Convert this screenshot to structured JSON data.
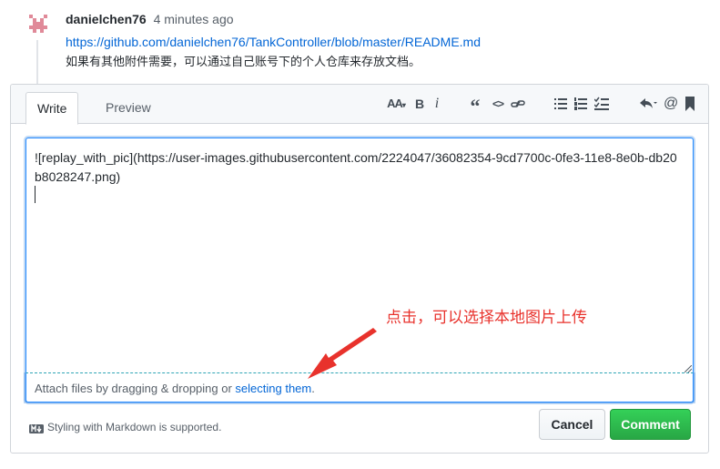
{
  "comment": {
    "author": "danielchen76",
    "time": "4 minutes ago",
    "link": "https://github.com/danielchen76/TankController/blob/master/README.md",
    "text": "如果有其他附件需要，可以通过自己账号下的个人仓库来存放文档。"
  },
  "editor": {
    "tabs": [
      {
        "label": "Write"
      },
      {
        "label": "Preview"
      }
    ],
    "toolbar": {
      "heading": "AA",
      "bold": "B",
      "italic": "i",
      "quote": "“",
      "code": "<>",
      "mention": "@",
      "icons": [
        "heading-icon",
        "bold-icon",
        "italic-icon",
        "quote-icon",
        "code-icon",
        "link-icon",
        "unordered-list-icon",
        "ordered-list-icon",
        "task-list-icon",
        "reply-icon",
        "mention-icon",
        "bookmark-icon"
      ]
    },
    "content": "![replay_with_pic](https://user-images.githubusercontent.com/2224047/36082354-9cd7700c-0fe3-11e8-8e0b-db20b8028247.png)",
    "attach_prefix": "Attach files by dragging & dropping or ",
    "attach_link": "selecting them",
    "attach_suffix": "."
  },
  "footer": {
    "markdown_note": "Styling with Markdown is supported.",
    "cancel_label": "Cancel",
    "comment_label": "Comment"
  },
  "annotation": {
    "text": "点击，可以选择本地图片上传",
    "color": "#e8322c"
  },
  "colors": {
    "link": "#0366d6",
    "primary_button": "#28a745",
    "focus": "#2188ff"
  }
}
